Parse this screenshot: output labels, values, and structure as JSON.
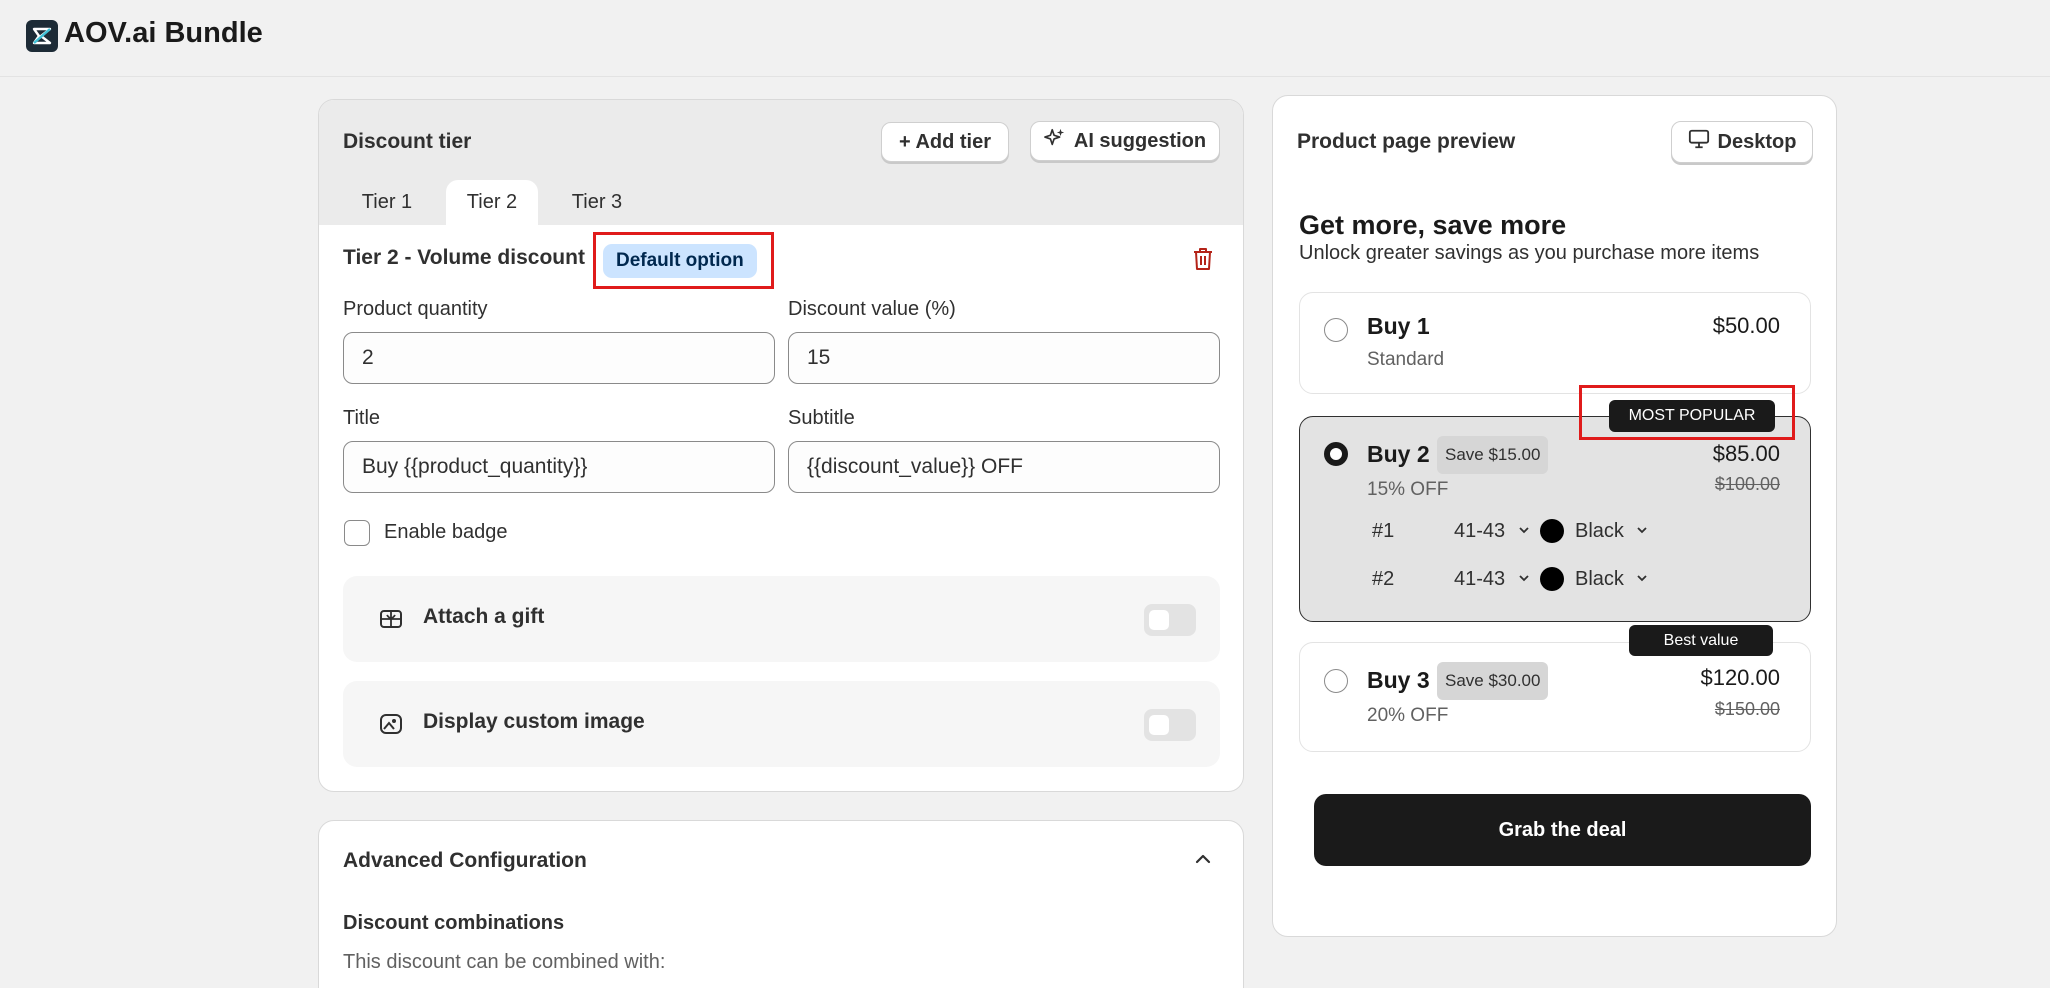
{
  "app": {
    "title": "AOV.ai Bundle",
    "logo_icon": "aov-logo-icon"
  },
  "discount_tier": {
    "heading": "Discount tier",
    "add_tier_label": "+ Add tier",
    "ai_suggestion_label": "AI suggestion",
    "tabs": [
      {
        "label": "Tier 1"
      },
      {
        "label": "Tier 2",
        "active": true
      },
      {
        "label": "Tier 3"
      }
    ],
    "tier_heading": "Tier 2 - Volume discount",
    "default_badge": "Default option",
    "fields": {
      "product_quantity": {
        "label": "Product quantity",
        "value": "2"
      },
      "discount_value": {
        "label": "Discount value (%)",
        "value": "15"
      },
      "title": {
        "label": "Title",
        "value": "Buy {{product_quantity}}"
      },
      "subtitle": {
        "label": "Subtitle",
        "value": "{{discount_value}} OFF"
      }
    },
    "enable_badge_label": "Enable badge",
    "attach_gift_label": "Attach a gift",
    "display_custom_image_label": "Display custom image"
  },
  "advanced": {
    "heading": "Advanced Configuration",
    "combinations_heading": "Discount combinations",
    "combinations_text": "This discount can be combined with:"
  },
  "preview": {
    "heading": "Product page preview",
    "device_label": "Desktop",
    "block_title": "Get more, save more",
    "block_subtitle": "Unlock greater savings as you purchase more items",
    "tiers": [
      {
        "title": "Buy 1",
        "subtitle": "Standard",
        "price": "$50.00"
      },
      {
        "title": "Buy 2",
        "save": "Save $15.00",
        "subtitle": "15% OFF",
        "price": "$85.00",
        "old_price": "$100.00",
        "badge": "MOST POPULAR",
        "variants": [
          {
            "index": "#1",
            "size": "41-43",
            "color": "Black"
          },
          {
            "index": "#2",
            "size": "41-43",
            "color": "Black"
          }
        ]
      },
      {
        "title": "Buy 3",
        "save": "Save $30.00",
        "subtitle": "20% OFF",
        "price": "$120.00",
        "old_price": "$150.00",
        "badge": "Best value"
      }
    ],
    "cta_label": "Grab the deal"
  },
  "colors": {
    "highlight": "#e01b1b",
    "default_badge_bg": "#cce4ff",
    "cta_bg": "#1a1a1a"
  }
}
